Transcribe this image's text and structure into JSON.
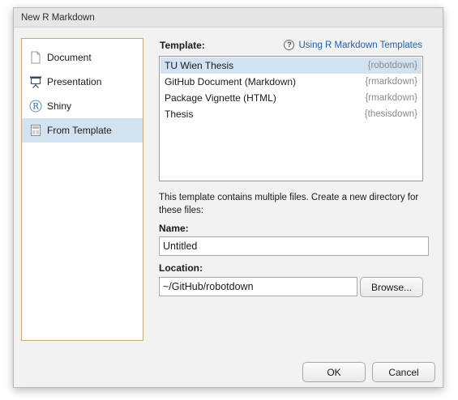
{
  "window": {
    "title": "New R Markdown"
  },
  "sidebar": {
    "items": [
      {
        "label": "Document",
        "icon": "document-icon"
      },
      {
        "label": "Presentation",
        "icon": "presentation-icon"
      },
      {
        "label": "Shiny",
        "icon": "shiny-icon"
      },
      {
        "label": "From Template",
        "icon": "template-icon",
        "selected": true
      }
    ]
  },
  "template": {
    "heading": "Template:",
    "help_link": "Using R Markdown Templates",
    "help_icon": "?",
    "items": [
      {
        "name": "TU Wien Thesis",
        "package": "{robotdown}",
        "selected": true
      },
      {
        "name": "GitHub Document (Markdown)",
        "package": "{rmarkdown}"
      },
      {
        "name": "Package Vignette (HTML)",
        "package": "{rmarkdown}"
      },
      {
        "name": "Thesis",
        "package": "{thesisdown}"
      }
    ]
  },
  "info": "This template contains multiple files. Create a new directory for these files:",
  "name_field": {
    "label": "Name:",
    "value": "Untitled"
  },
  "location_field": {
    "label": "Location:",
    "value": "~/GitHub/robotdown"
  },
  "buttons": {
    "browse": "Browse...",
    "ok": "OK",
    "cancel": "Cancel"
  },
  "colors": {
    "selection": "#d3e2f0",
    "link": "#1f5fa8",
    "package_text": "#8a8a8a",
    "sidebar_border": "#c9a87a"
  }
}
